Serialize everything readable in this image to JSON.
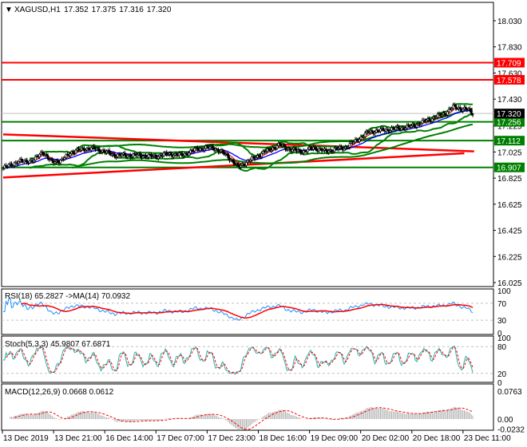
{
  "header": {
    "symbol": "XAGUSD,H1",
    "open": "17.352",
    "high": "17.375",
    "low": "17.316",
    "close": "17.320"
  },
  "chart_data": {
    "type": "candlestick",
    "title": "XAGUSD,H1",
    "price_ticks": [
      "18.030",
      "17.830",
      "17.630",
      "17.430",
      "17.225",
      "17.025",
      "16.825",
      "16.625",
      "16.425",
      "16.225",
      "16.025"
    ],
    "ylim": [
      16.025,
      18.03
    ],
    "time_labels": [
      "13 Dec 2019",
      "13 Dec 21:00",
      "16 Dec 14:00",
      "17 Dec 07:00",
      "17 Dec 23:00",
      "18 Dec 16:00",
      "19 Dec 09:00",
      "20 Dec 02:00",
      "20 Dec 18:00",
      "23 Dec 11:00"
    ],
    "close_anchors": [
      [
        0,
        16.9
      ],
      [
        10,
        16.95
      ],
      [
        22,
        16.96
      ],
      [
        28,
        17.03
      ],
      [
        34,
        16.95
      ],
      [
        42,
        16.96
      ],
      [
        48,
        17.02
      ],
      [
        58,
        17.05
      ],
      [
        66,
        17.05
      ],
      [
        72,
        17.03
      ],
      [
        80,
        17.0
      ],
      [
        95,
        17.0
      ],
      [
        108,
        16.99
      ],
      [
        118,
        17.01
      ],
      [
        128,
        17.0
      ],
      [
        139,
        17.05
      ],
      [
        150,
        17.06
      ],
      [
        160,
        17.0
      ],
      [
        168,
        16.91
      ],
      [
        178,
        16.97
      ],
      [
        188,
        17.03
      ],
      [
        198,
        17.08
      ],
      [
        206,
        17.04
      ],
      [
        216,
        17.03
      ],
      [
        222,
        17.06
      ],
      [
        230,
        17.03
      ],
      [
        245,
        17.06
      ],
      [
        255,
        17.13
      ],
      [
        262,
        17.18
      ],
      [
        278,
        17.2
      ],
      [
        292,
        17.22
      ],
      [
        304,
        17.27
      ],
      [
        316,
        17.32
      ],
      [
        322,
        17.37
      ],
      [
        332,
        17.35
      ],
      [
        336,
        17.32
      ]
    ],
    "bar_count": 337,
    "levels": [
      {
        "label": "17.709",
        "price": 17.709,
        "color": "#ff0000"
      },
      {
        "label": "17.578",
        "price": 17.578,
        "color": "#ff0000"
      },
      {
        "label": "17.256",
        "price": 17.256,
        "color": "#008000"
      },
      {
        "label": "17.112",
        "price": 17.112,
        "color": "#008000"
      },
      {
        "label": "16.907",
        "price": 16.907,
        "color": "#008000"
      }
    ],
    "current_price": {
      "label": "17.320",
      "price": 17.32
    },
    "trendlines": [
      {
        "from": [
          0,
          17.16
        ],
        "to": [
          337,
          17.03
        ],
        "color": "#ff0000"
      },
      {
        "from": [
          0,
          16.83
        ],
        "to": [
          330,
          17.015
        ],
        "color": "#ff0000"
      }
    ],
    "indicators": {
      "rsi": {
        "label": "RSI(18) 65.2827  ->MA(14) 70.0932",
        "levels": [
          "100",
          "70",
          "30",
          "0"
        ]
      },
      "stoch": {
        "label": "Stoch(5,3,3) 45.9807 67.6871",
        "levels": [
          "100",
          "80",
          "20",
          "0"
        ]
      },
      "macd": {
        "label": "MACD(12,26,9) 0.0668 0.0612",
        "levels": [
          "0.0763",
          "0.00",
          "-0.0232"
        ]
      }
    }
  }
}
